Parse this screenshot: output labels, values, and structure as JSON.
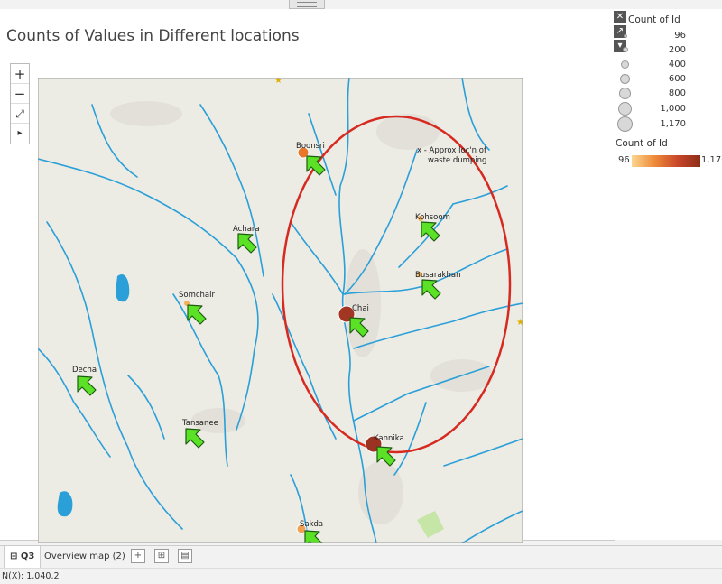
{
  "title": "Counts of Values in Different locations",
  "zoom_controls": {
    "zoom_in": "+",
    "zoom_out": "−",
    "pan": "⤢",
    "expand": "▸"
  },
  "map": {
    "cities": [
      "Boonsri",
      "Achara",
      "Somchair",
      "Decha",
      "Tansanee",
      "Kohsoom",
      "Busarakhan",
      "Chai",
      "Kannika",
      "Sakda"
    ],
    "annotation_lines": [
      "x - Approx loc'n of",
      "waste dumping"
    ],
    "colors": {
      "water": "#2a9fd8",
      "ellipse": "#d62a21",
      "arrow": "#5be226",
      "land": "#eceae3"
    }
  },
  "legend": {
    "size_title": "Count of Id",
    "size_values": [
      "96",
      "200",
      "400",
      "600",
      "800",
      "1,000",
      "1,170"
    ],
    "color_title": "Count of Id",
    "color_min": "96",
    "color_max": "1,170"
  },
  "tabs": {
    "active": "Q3",
    "other": "Overview map (2)"
  },
  "status": "N(X): 1,040.2"
}
